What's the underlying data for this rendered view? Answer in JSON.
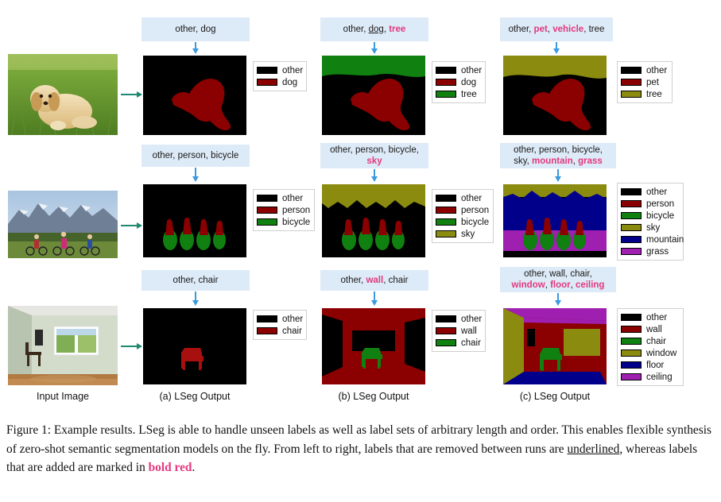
{
  "figure": {
    "column_captions": [
      "Input Image",
      "(a) LSeg Output",
      "(b) LSeg Output",
      "(c) LSeg Output"
    ],
    "caption": {
      "prefix": "Figure 1: Example results. LSeg is able to handle unseen labels as well as label sets of arbitrary length and order. This enables flexible synthesis of zero-shot semantic segmentation models on the fly. From left to right, labels that are removed between runs are ",
      "underlined_word": "underlined",
      "middle": ", whereas labels that are added are marked in ",
      "bold_red_word": "bold red",
      "suffix": "."
    },
    "colors": {
      "other": "#000000",
      "dog": "#8b0000",
      "pet": "#8b0000",
      "person": "#8b0000",
      "wall": "#8b0000",
      "chair_a": "#8b0000",
      "tree_green": "#108010",
      "tree_olive": "#8b8b10",
      "bicycle": "#108010",
      "chair_green": "#108010",
      "sky": "#8b8b10",
      "window": "#8b8b10",
      "mountain": "#00008b",
      "floor": "#00008b",
      "grass": "#9e1fb0",
      "ceiling": "#9e1fb0",
      "label_box_bg": "#ddeaf7",
      "highlight_red": "#e3397f",
      "down_arrow": "#3a9ae0",
      "right_arrow": "#1f8a70"
    },
    "rows": [
      {
        "id": "dog-row",
        "panels": [
          {
            "id": "a",
            "label_parts": [
              {
                "text": "other, dog",
                "style": "plain"
              }
            ],
            "legend": [
              {
                "name": "other",
                "color": "#000000"
              },
              {
                "name": "dog",
                "color": "#8b0000"
              }
            ]
          },
          {
            "id": "b",
            "label_parts": [
              {
                "text": "other, ",
                "style": "plain"
              },
              {
                "text": "dog",
                "style": "underline"
              },
              {
                "text": ", ",
                "style": "plain"
              },
              {
                "text": "tree",
                "style": "red"
              }
            ],
            "legend": [
              {
                "name": "other",
                "color": "#000000"
              },
              {
                "name": "dog",
                "color": "#8b0000"
              },
              {
                "name": "tree",
                "color": "#108010"
              }
            ]
          },
          {
            "id": "c",
            "label_parts": [
              {
                "text": "other, ",
                "style": "plain"
              },
              {
                "text": "pet",
                "style": "red"
              },
              {
                "text": ", ",
                "style": "plain"
              },
              {
                "text": "vehicle",
                "style": "red"
              },
              {
                "text": ", tree",
                "style": "plain"
              }
            ],
            "legend": [
              {
                "name": "other",
                "color": "#000000"
              },
              {
                "name": "pet",
                "color": "#8b0000"
              },
              {
                "name": "tree",
                "color": "#8b8b10"
              }
            ]
          }
        ]
      },
      {
        "id": "cyclists-row",
        "panels": [
          {
            "id": "a",
            "label_parts": [
              {
                "text": "other, person, bicycle",
                "style": "plain"
              }
            ],
            "legend": [
              {
                "name": "other",
                "color": "#000000"
              },
              {
                "name": "person",
                "color": "#8b0000"
              },
              {
                "name": "bicycle",
                "color": "#108010"
              }
            ]
          },
          {
            "id": "b",
            "label_parts": [
              {
                "text": "other, person, bicycle,",
                "style": "plain"
              },
              {
                "text": "\n",
                "style": "break"
              },
              {
                "text": "sky",
                "style": "red"
              }
            ],
            "legend": [
              {
                "name": "other",
                "color": "#000000"
              },
              {
                "name": "person",
                "color": "#8b0000"
              },
              {
                "name": "bicycle",
                "color": "#108010"
              },
              {
                "name": "sky",
                "color": "#8b8b10"
              }
            ]
          },
          {
            "id": "c",
            "label_parts": [
              {
                "text": "other, person, bicycle,",
                "style": "plain"
              },
              {
                "text": "\n",
                "style": "break"
              },
              {
                "text": "sky, ",
                "style": "plain"
              },
              {
                "text": "mountain",
                "style": "red"
              },
              {
                "text": ", ",
                "style": "plain"
              },
              {
                "text": "grass",
                "style": "red"
              }
            ],
            "legend": [
              {
                "name": "other",
                "color": "#000000"
              },
              {
                "name": "person",
                "color": "#8b0000"
              },
              {
                "name": "bicycle",
                "color": "#108010"
              },
              {
                "name": "sky",
                "color": "#8b8b10"
              },
              {
                "name": "mountain",
                "color": "#00008b"
              },
              {
                "name": "grass",
                "color": "#9e1fb0"
              }
            ]
          }
        ]
      },
      {
        "id": "room-row",
        "panels": [
          {
            "id": "a",
            "label_parts": [
              {
                "text": "other, chair",
                "style": "plain"
              }
            ],
            "legend": [
              {
                "name": "other",
                "color": "#000000"
              },
              {
                "name": "chair",
                "color": "#8b0000"
              }
            ]
          },
          {
            "id": "b",
            "label_parts": [
              {
                "text": "other, ",
                "style": "plain"
              },
              {
                "text": "wall",
                "style": "red"
              },
              {
                "text": ", chair",
                "style": "plain"
              }
            ],
            "legend": [
              {
                "name": "other",
                "color": "#000000"
              },
              {
                "name": "wall",
                "color": "#8b0000"
              },
              {
                "name": "chair",
                "color": "#108010"
              }
            ]
          },
          {
            "id": "c",
            "label_parts": [
              {
                "text": "other, wall, chair,",
                "style": "plain"
              },
              {
                "text": "\n",
                "style": "break"
              },
              {
                "text": "window",
                "style": "red"
              },
              {
                "text": ", ",
                "style": "plain"
              },
              {
                "text": "floor",
                "style": "red"
              },
              {
                "text": ", ",
                "style": "plain"
              },
              {
                "text": "ceiling",
                "style": "red"
              }
            ],
            "legend": [
              {
                "name": "other",
                "color": "#000000"
              },
              {
                "name": "wall",
                "color": "#8b0000"
              },
              {
                "name": "chair",
                "color": "#108010"
              },
              {
                "name": "window",
                "color": "#8b8b10"
              },
              {
                "name": "floor",
                "color": "#00008b"
              },
              {
                "name": "ceiling",
                "color": "#9e1fb0"
              }
            ]
          }
        ]
      }
    ]
  }
}
